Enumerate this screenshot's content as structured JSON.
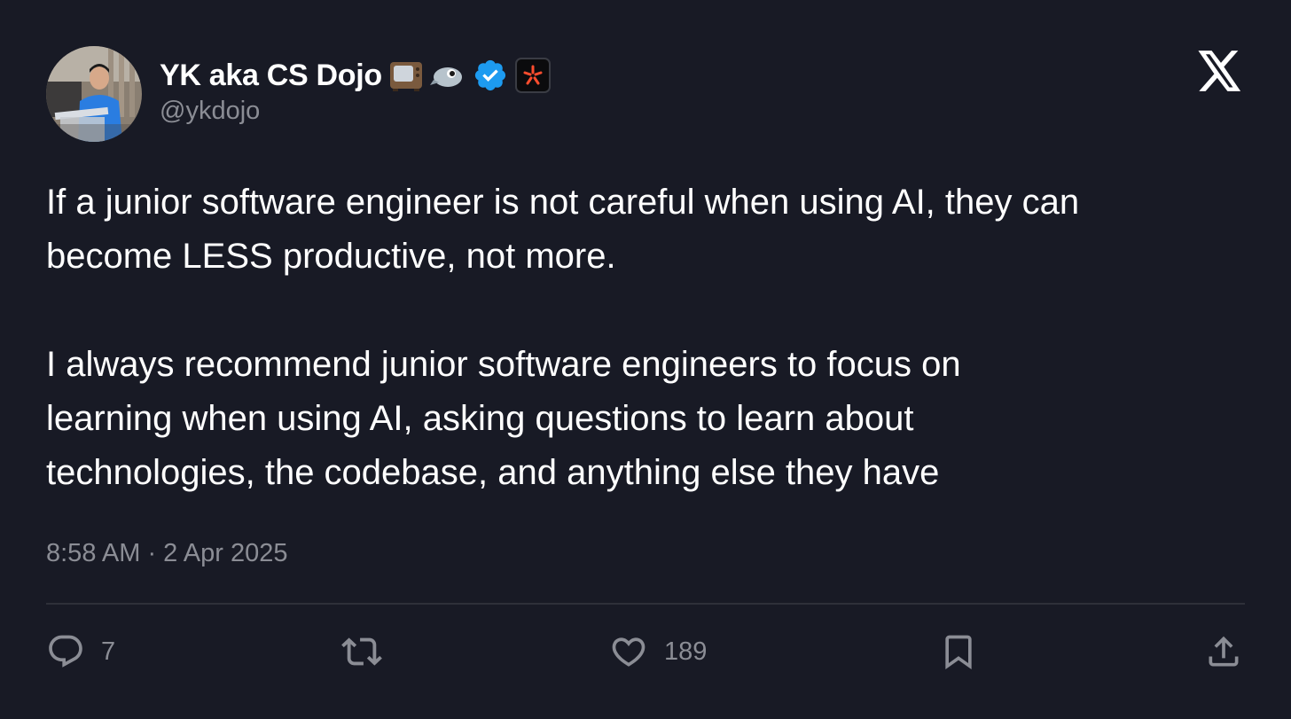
{
  "author": {
    "display_name": "YK aka CS Dojo",
    "handle": "@ykdojo",
    "name_icons": [
      "tv-icon",
      "bird-icon",
      "verified-badge-icon",
      "affiliate-badge-icon"
    ]
  },
  "tweet": {
    "paragraph_1": [
      "If a junior software engineer is not careful when using AI, they can",
      "become LESS productive, not more."
    ],
    "paragraph_2": [
      "I always recommend junior software engineers to focus on",
      "learning when using AI, asking questions to learn about",
      "technologies, the codebase, and anything else they have"
    ],
    "timestamp": "8:58 AM · 2 Apr 2025"
  },
  "actions": {
    "replies": "7",
    "reposts": "",
    "likes": "189"
  },
  "colors": {
    "background": "#181a25",
    "text": "#ffffff",
    "muted": "#8b8d95",
    "verified": "#1d9bf0",
    "divider": "#2e3039"
  }
}
